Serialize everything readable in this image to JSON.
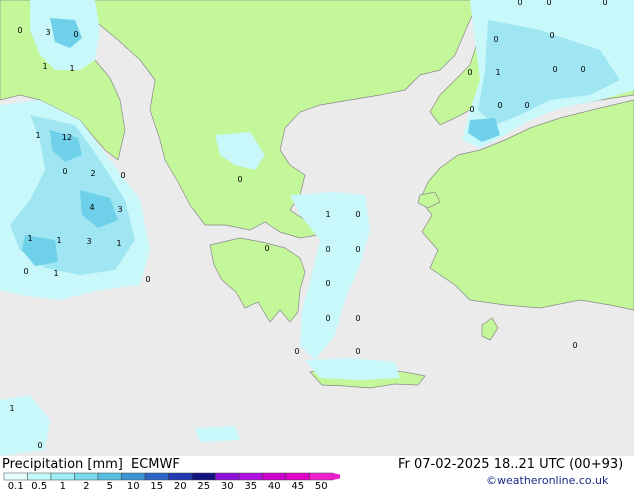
{
  "title": {
    "product": "Precipitation [mm]",
    "model": "ECMWF",
    "valid_time": "Fr 07-02-2025 18..21 UTC (00+93)",
    "credit": "©weatheronline.co.uk"
  },
  "legend": {
    "ticks": [
      "0.1",
      "0.5",
      "1",
      "2",
      "5",
      "10",
      "15",
      "20",
      "25",
      "30",
      "35",
      "40",
      "45",
      "50"
    ],
    "colors": [
      "#e6ffff",
      "#c3f9fb",
      "#9fedf5",
      "#7ad9ec",
      "#56bfe0",
      "#3a94d2",
      "#2b64c4",
      "#1f3ab0",
      "#12137e",
      "#8c10d8",
      "#b010e0",
      "#cc00cc",
      "#e000c8",
      "#f020d0"
    ]
  },
  "colors": {
    "sea": "#ebebeb",
    "land": "#c3f79a",
    "border": "#7a7a7a",
    "precip_light": "#c8f8fa",
    "precip_mid": "#9fe6f2",
    "precip_heavy": "#6fd0ea"
  },
  "point_values": [
    {
      "label": "0"
    },
    {
      "label": "3"
    },
    {
      "label": "0"
    },
    {
      "label": "1"
    },
    {
      "label": "1"
    },
    {
      "label": "1"
    },
    {
      "label": "12"
    },
    {
      "label": "0"
    },
    {
      "label": "2"
    },
    {
      "label": "0"
    },
    {
      "label": "4"
    },
    {
      "label": "3"
    },
    {
      "label": "1"
    },
    {
      "label": "1"
    },
    {
      "label": "3"
    },
    {
      "label": "1"
    },
    {
      "label": "0"
    },
    {
      "label": "1"
    },
    {
      "label": "0"
    },
    {
      "label": "0"
    },
    {
      "label": "1"
    },
    {
      "label": "0"
    },
    {
      "label": "0"
    },
    {
      "label": "0"
    },
    {
      "label": "0"
    },
    {
      "label": "0"
    },
    {
      "label": "0"
    },
    {
      "label": "0"
    },
    {
      "label": "0"
    },
    {
      "label": "0"
    },
    {
      "label": "0"
    },
    {
      "label": "0"
    },
    {
      "label": "0"
    },
    {
      "label": "0"
    },
    {
      "label": "1"
    },
    {
      "label": "0"
    },
    {
      "label": "0"
    },
    {
      "label": "0"
    },
    {
      "label": "0"
    },
    {
      "label": "0"
    },
    {
      "label": "0"
    },
    {
      "label": "0"
    },
    {
      "label": "0"
    },
    {
      "label": "1"
    },
    {
      "label": "0"
    }
  ]
}
